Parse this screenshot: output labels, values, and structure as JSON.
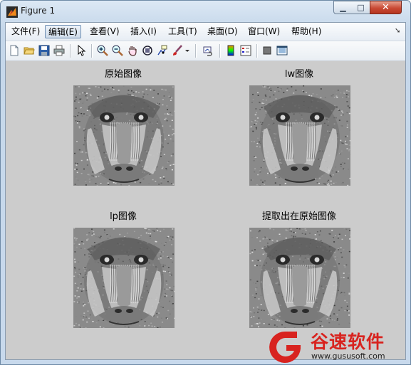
{
  "window": {
    "title": "Figure 1"
  },
  "menubar": {
    "items": [
      {
        "label": "文件(F)"
      },
      {
        "label": "编辑(E)"
      },
      {
        "label": "查看(V)"
      },
      {
        "label": "插入(I)"
      },
      {
        "label": "工具(T)"
      },
      {
        "label": "桌面(D)"
      },
      {
        "label": "窗口(W)"
      },
      {
        "label": "帮助(H)"
      }
    ]
  },
  "toolbar": {
    "icons": [
      "new-figure-icon",
      "open-file-icon",
      "save-icon",
      "print-icon",
      "pointer-icon",
      "zoom-in-icon",
      "zoom-out-icon",
      "pan-hand-icon",
      "rotate-3d-icon",
      "data-cursor-icon",
      "brush-icon",
      "link-plot-icon",
      "colorbar-icon",
      "legend-icon",
      "hide-plot-tools-icon",
      "show-plot-tools-icon"
    ]
  },
  "subplots": [
    {
      "title": "原始图像"
    },
    {
      "title": "lw图像"
    },
    {
      "title": "lp图像"
    },
    {
      "title": "提取出在原始图像"
    }
  ],
  "watermark": {
    "brand": "谷速软件",
    "url": "www.gususoft.com",
    "color": "#d8231f"
  }
}
